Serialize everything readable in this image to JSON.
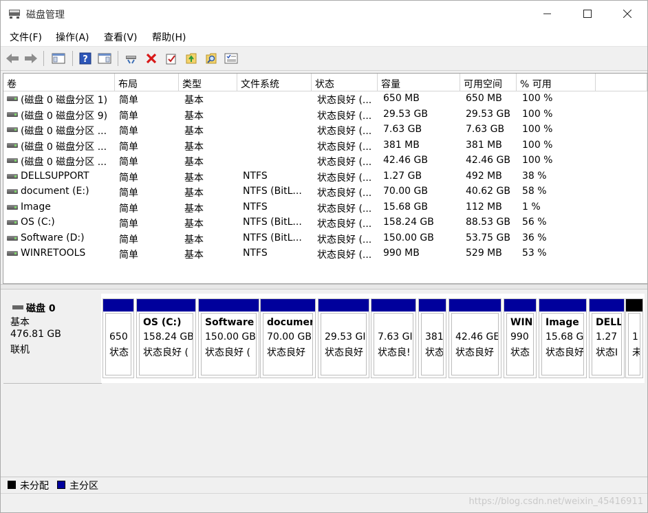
{
  "window": {
    "title": "磁盘管理"
  },
  "menu": [
    "文件(F)",
    "操作(A)",
    "查看(V)",
    "帮助(H)"
  ],
  "toolbar_icons": [
    "back-icon",
    "forward-icon",
    "console-tree-icon",
    "help-icon",
    "properties-pane-icon",
    "connect-icon",
    "delete-icon",
    "check-icon",
    "refresh-icon",
    "search-icon",
    "list-icon"
  ],
  "columns": [
    "卷",
    "布局",
    "类型",
    "文件系统",
    "状态",
    "容量",
    "可用空间",
    "% 可用"
  ],
  "volumes": [
    {
      "name": "(磁盘 0 磁盘分区 1)",
      "layout": "简单",
      "type": "基本",
      "fs": "",
      "status": "状态良好 (...",
      "capacity": "650 MB",
      "free": "650 MB",
      "pct": "100 %"
    },
    {
      "name": "(磁盘 0 磁盘分区 9)",
      "layout": "简单",
      "type": "基本",
      "fs": "",
      "status": "状态良好 (...",
      "capacity": "29.53 GB",
      "free": "29.53 GB",
      "pct": "100 %"
    },
    {
      "name": "(磁盘 0 磁盘分区 ...",
      "layout": "简单",
      "type": "基本",
      "fs": "",
      "status": "状态良好 (...",
      "capacity": "7.63 GB",
      "free": "7.63 GB",
      "pct": "100 %"
    },
    {
      "name": "(磁盘 0 磁盘分区 ...",
      "layout": "简单",
      "type": "基本",
      "fs": "",
      "status": "状态良好 (...",
      "capacity": "381 MB",
      "free": "381 MB",
      "pct": "100 %"
    },
    {
      "name": "(磁盘 0 磁盘分区 ...",
      "layout": "简单",
      "type": "基本",
      "fs": "",
      "status": "状态良好 (...",
      "capacity": "42.46 GB",
      "free": "42.46 GB",
      "pct": "100 %"
    },
    {
      "name": "DELLSUPPORT",
      "layout": "简单",
      "type": "基本",
      "fs": "NTFS",
      "status": "状态良好 (...",
      "capacity": "1.27 GB",
      "free": "492 MB",
      "pct": "38 %"
    },
    {
      "name": "document (E:)",
      "layout": "简单",
      "type": "基本",
      "fs": "NTFS (BitL...",
      "status": "状态良好 (...",
      "capacity": "70.00 GB",
      "free": "40.62 GB",
      "pct": "58 %"
    },
    {
      "name": "Image",
      "layout": "简单",
      "type": "基本",
      "fs": "NTFS",
      "status": "状态良好 (...",
      "capacity": "15.68 GB",
      "free": "112 MB",
      "pct": "1 %"
    },
    {
      "name": "OS (C:)",
      "layout": "简单",
      "type": "基本",
      "fs": "NTFS (BitL...",
      "status": "状态良好 (...",
      "capacity": "158.24 GB",
      "free": "88.53 GB",
      "pct": "56 %"
    },
    {
      "name": "Software (D:)",
      "layout": "简单",
      "type": "基本",
      "fs": "NTFS (BitL...",
      "status": "状态良好 (...",
      "capacity": "150.00 GB",
      "free": "53.75 GB",
      "pct": "36 %"
    },
    {
      "name": "WINRETOOLS",
      "layout": "简单",
      "type": "基本",
      "fs": "NTFS",
      "status": "状态良好 (...",
      "capacity": "990 MB",
      "free": "529 MB",
      "pct": "53 %"
    }
  ],
  "disk": {
    "name": "磁盘 0",
    "kind": "基本",
    "size": "476.81 GB",
    "state": "联机"
  },
  "partitions": [
    {
      "name": "",
      "size": "650",
      "status": "状态",
      "bar": "#00009c"
    },
    {
      "name": "OS  (C:)",
      "size": "158.24 GB",
      "status": "状态良好 (",
      "bar": "#00009c"
    },
    {
      "name": "Software",
      "size": "150.00 GB",
      "status": "状态良好 (",
      "bar": "#00009c"
    },
    {
      "name": "documer",
      "size": "70.00 GB",
      "status": "状态良好",
      "bar": "#00009c"
    },
    {
      "name": "",
      "size": "29.53 GI",
      "status": "状态良好",
      "bar": "#00009c"
    },
    {
      "name": "",
      "size": "7.63 GI",
      "status": "状态良!",
      "bar": "#00009c"
    },
    {
      "name": "",
      "size": "381",
      "status": "状态",
      "bar": "#00009c"
    },
    {
      "name": "",
      "size": "42.46 GE",
      "status": "状态良好",
      "bar": "#00009c"
    },
    {
      "name": "WIN",
      "size": "990",
      "status": "状态",
      "bar": "#00009c"
    },
    {
      "name": "Image",
      "size": "15.68 G",
      "status": "状态良好",
      "bar": "#00009c"
    },
    {
      "name": "DELL",
      "size": "1.27",
      "status": "状态I",
      "bar": "#00009c"
    },
    {
      "name": "",
      "size": "1",
      "status": "未",
      "bar": "#000000"
    }
  ],
  "legend": [
    {
      "label": "未分配",
      "color": "#000000"
    },
    {
      "label": "主分区",
      "color": "#00009c"
    }
  ],
  "watermark": "https://blog.csdn.net/weixin_45416911"
}
